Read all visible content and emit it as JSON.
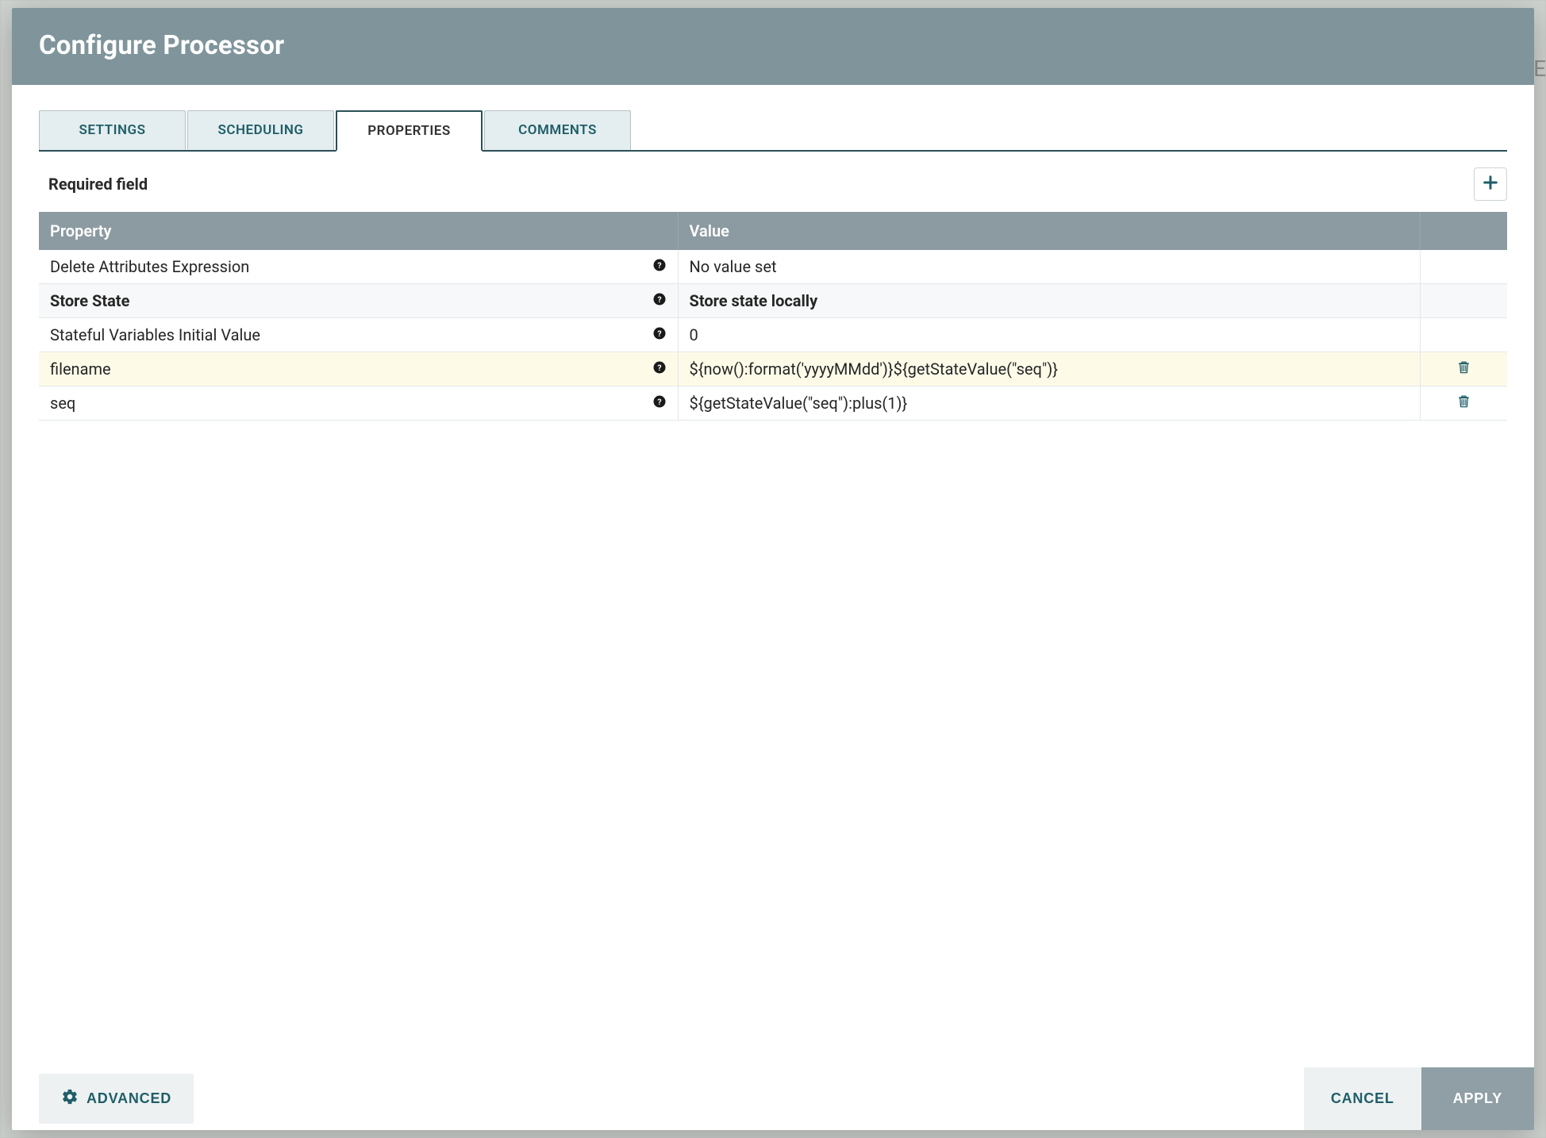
{
  "dialog": {
    "title": "Configure Processor"
  },
  "tabs": [
    {
      "id": "settings",
      "label": "SETTINGS",
      "active": false
    },
    {
      "id": "scheduling",
      "label": "SCHEDULING",
      "active": false
    },
    {
      "id": "properties",
      "label": "PROPERTIES",
      "active": true
    },
    {
      "id": "comments",
      "label": "COMMENTS",
      "active": false
    }
  ],
  "section": {
    "required_label": "Required field"
  },
  "table": {
    "headers": {
      "property": "Property",
      "value": "Value"
    },
    "rows": [
      {
        "property": "Delete Attributes Expression",
        "bold": false,
        "value": "No value set",
        "placeholder": true,
        "deletable": false,
        "highlight": false,
        "striped": false
      },
      {
        "property": "Store State",
        "bold": true,
        "value": "Store state locally",
        "placeholder": false,
        "deletable": false,
        "highlight": false,
        "striped": true
      },
      {
        "property": "Stateful Variables Initial Value",
        "bold": false,
        "value": "0",
        "placeholder": false,
        "deletable": false,
        "highlight": false,
        "striped": false
      },
      {
        "property": "filename",
        "bold": false,
        "value": "${now():format('yyyyMMdd')}${getStateValue(\"seq\")}",
        "placeholder": false,
        "deletable": true,
        "highlight": true,
        "striped": false
      },
      {
        "property": "seq",
        "bold": false,
        "value": "${getStateValue(\"seq\"):plus(1)}",
        "placeholder": false,
        "deletable": true,
        "highlight": false,
        "striped": false
      }
    ]
  },
  "buttons": {
    "advanced": "ADVANCED",
    "cancel": "CANCEL",
    "apply": "APPLY"
  },
  "icons": {
    "add": "plus-icon",
    "help": "question-circle-icon",
    "trash": "trash-icon",
    "gear": "gear-icon"
  }
}
